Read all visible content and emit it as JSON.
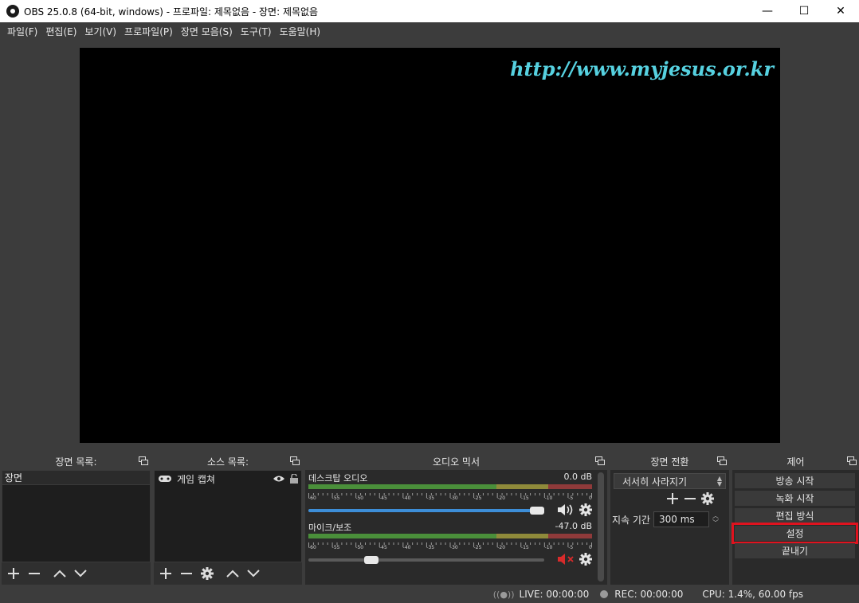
{
  "window": {
    "title": "OBS 25.0.8 (64-bit, windows) - 프로파일: 제목없음 - 장면: 제목없음",
    "minimize": "—",
    "maximize": "☐",
    "close": "✕"
  },
  "menu": [
    "파일(F)",
    "편집(E)",
    "보기(V)",
    "프로파일(P)",
    "장면 모음(S)",
    "도구(T)",
    "도움말(H)"
  ],
  "preview": {
    "watermark": "http://www.myjesus.or.kr"
  },
  "scenes": {
    "title": "장면 목록:",
    "items": [
      "장면"
    ]
  },
  "sources": {
    "title": "소스 목록:",
    "items": [
      "게임 캡쳐"
    ]
  },
  "mixer": {
    "title": "오디오 믹서",
    "channels": [
      {
        "name": "데스크탑 오디오",
        "level": "0.0 dB",
        "volume": 1.0,
        "muted": false
      },
      {
        "name": "마이크/보조",
        "level": "-47.0 dB",
        "volume": 0.25,
        "muted": true
      }
    ],
    "ticks": [
      "-60",
      "-55",
      "-50",
      "-45",
      "-40",
      "-35",
      "-30",
      "-25",
      "-20",
      "-15",
      "-10",
      "-5",
      "0"
    ]
  },
  "transitions": {
    "title": "장면 전환",
    "selected": "서서히 사라지기",
    "duration_label": "지속 기간",
    "duration_value": "300 ms"
  },
  "controls": {
    "title": "제어",
    "buttons": [
      "방송 시작",
      "녹화 시작",
      "편집 방식",
      "설정",
      "끝내기"
    ]
  },
  "status": {
    "live": "LIVE: 00:00:00",
    "rec": "REC: 00:00:00",
    "cpu": "CPU: 1.4%, 60.00 fps"
  },
  "colors": {
    "highlight": "#e0121e",
    "volume_fill": "#3d8ed8",
    "watermark": "#56d1e0",
    "mute_red": "#d82b2b"
  }
}
